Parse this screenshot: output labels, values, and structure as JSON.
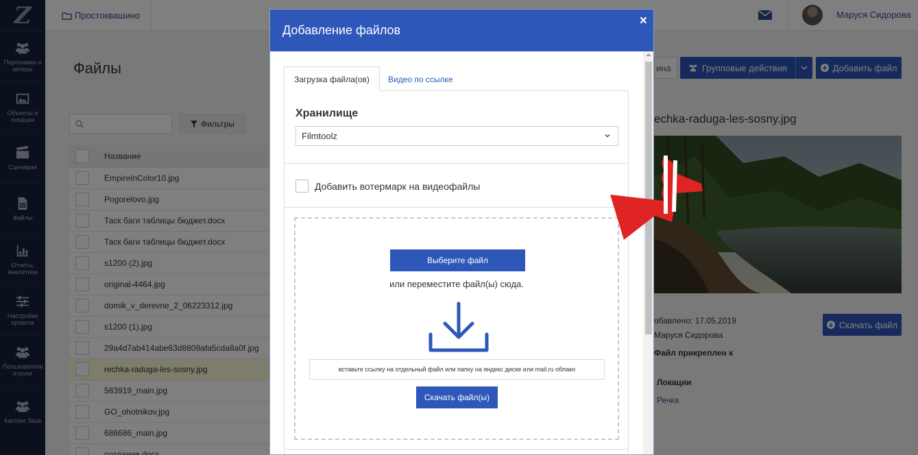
{
  "sidebar": {
    "logo": "Z",
    "items": [
      {
        "label": "Персонажи и актеры",
        "icon": "users-icon"
      },
      {
        "label": "Объекты и локации",
        "icon": "image-icon"
      },
      {
        "label": "Сценарии",
        "icon": "clapperboard-icon"
      },
      {
        "label": "Файлы",
        "icon": "file-icon"
      },
      {
        "label": "Отчеты, аналитика",
        "icon": "chart-icon"
      },
      {
        "label": "Настройки проекта",
        "icon": "sliders-icon"
      },
      {
        "label": "Пользователи и роли",
        "icon": "users-icon"
      },
      {
        "label": "Кастинг база",
        "icon": "users-icon"
      }
    ]
  },
  "topbar": {
    "project": "Простоквашино",
    "user_name": "Маруся Сидорова"
  },
  "page": {
    "title": "Файлы",
    "filters_label": "Фильтры",
    "table_header": "Название",
    "files": [
      "EmpireInColor10.jpg",
      "Pogorelovo.jpg",
      "Таск баги таблицы бюджет.docx",
      "Таск баги таблицы бюджет.docx",
      "s1200 (2).jpg",
      "original-4464.jpg",
      "domik_v_derevne_2_06223312.jpg",
      "s1200 (1).jpg",
      "29a4d7ab414abe63d8808afa5cda8a0f.jpg",
      "rechka-raduga-les-sosny.jpg",
      "583919_main.jpg",
      "GO_ohotnikov.jpg",
      "686686_main.jpg",
      "создание.docx"
    ],
    "active_file_index": 9,
    "header_buttons": {
      "partial": "ина",
      "group_actions": "Групповые действия",
      "add_file": "Добавить файл"
    },
    "preview": {
      "title": "echka-raduga-les-sosny.jpg",
      "added": "обавлено: 17.05.2019",
      "author": "Маруся Сидорова",
      "attached": "Файл прикреплен к",
      "section": "Локации",
      "location": "Речка",
      "download": "Скачать файл"
    }
  },
  "modal": {
    "title": "Добавление файлов",
    "close": "×",
    "tabs": [
      "Загрузка файла(ов)",
      "Видео по ссылке"
    ],
    "storage_label": "Хранилище",
    "storage_value": "Filmtoolz",
    "watermark_label": "Добавить вотермарк на видеофайлы",
    "watermark_checked": false,
    "choose_button": "Выберите файл",
    "drop_hint": "или переместите файл(ы) сюда.",
    "link_placeholder": "вставьте ссылку на отдельный файл или папку на яндекс диске или mail.ru облако",
    "download_button": "Скачать файл(ы)"
  },
  "colors": {
    "primary": "#2d57b9",
    "sidebar": "#17203a",
    "annotation": "#e02323"
  }
}
